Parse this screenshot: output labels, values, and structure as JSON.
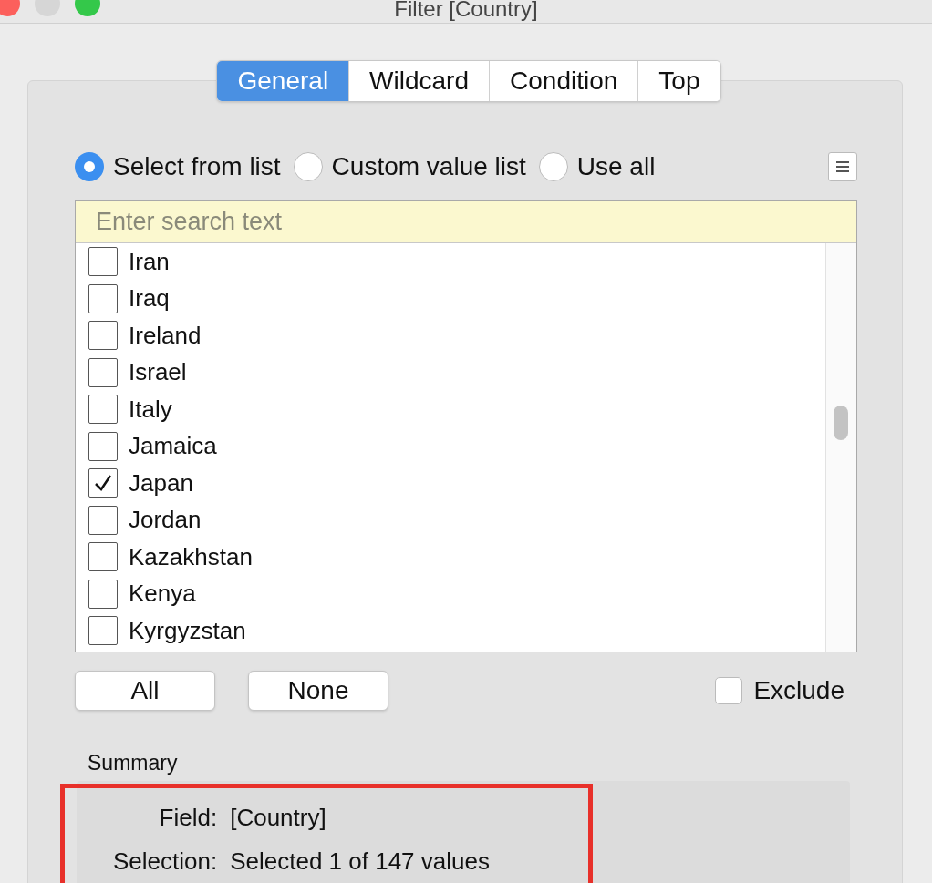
{
  "window": {
    "title": "Filter [Country]"
  },
  "tabs": [
    {
      "label": "General",
      "selected": true
    },
    {
      "label": "Wildcard",
      "selected": false
    },
    {
      "label": "Condition",
      "selected": false
    },
    {
      "label": "Top",
      "selected": false
    }
  ],
  "modes": [
    {
      "label": "Select from list",
      "selected": true
    },
    {
      "label": "Custom value list",
      "selected": false
    },
    {
      "label": "Use all",
      "selected": false
    }
  ],
  "search": {
    "placeholder": "Enter search text"
  },
  "items": [
    {
      "label": "Iran",
      "checked": false
    },
    {
      "label": "Iraq",
      "checked": false
    },
    {
      "label": "Ireland",
      "checked": false
    },
    {
      "label": "Israel",
      "checked": false
    },
    {
      "label": "Italy",
      "checked": false
    },
    {
      "label": "Jamaica",
      "checked": false
    },
    {
      "label": "Japan",
      "checked": true
    },
    {
      "label": "Jordan",
      "checked": false
    },
    {
      "label": "Kazakhstan",
      "checked": false
    },
    {
      "label": "Kenya",
      "checked": false
    },
    {
      "label": "Kyrgyzstan",
      "checked": false
    }
  ],
  "buttons": [
    "All",
    "None"
  ],
  "exclude": {
    "label": "Exclude",
    "checked": false
  },
  "summary": {
    "title": "Summary",
    "rows": [
      {
        "label": "Field:",
        "value": "[Country]"
      },
      {
        "label": "Selection:",
        "value": "Selected 1 of 147 values"
      }
    ]
  }
}
